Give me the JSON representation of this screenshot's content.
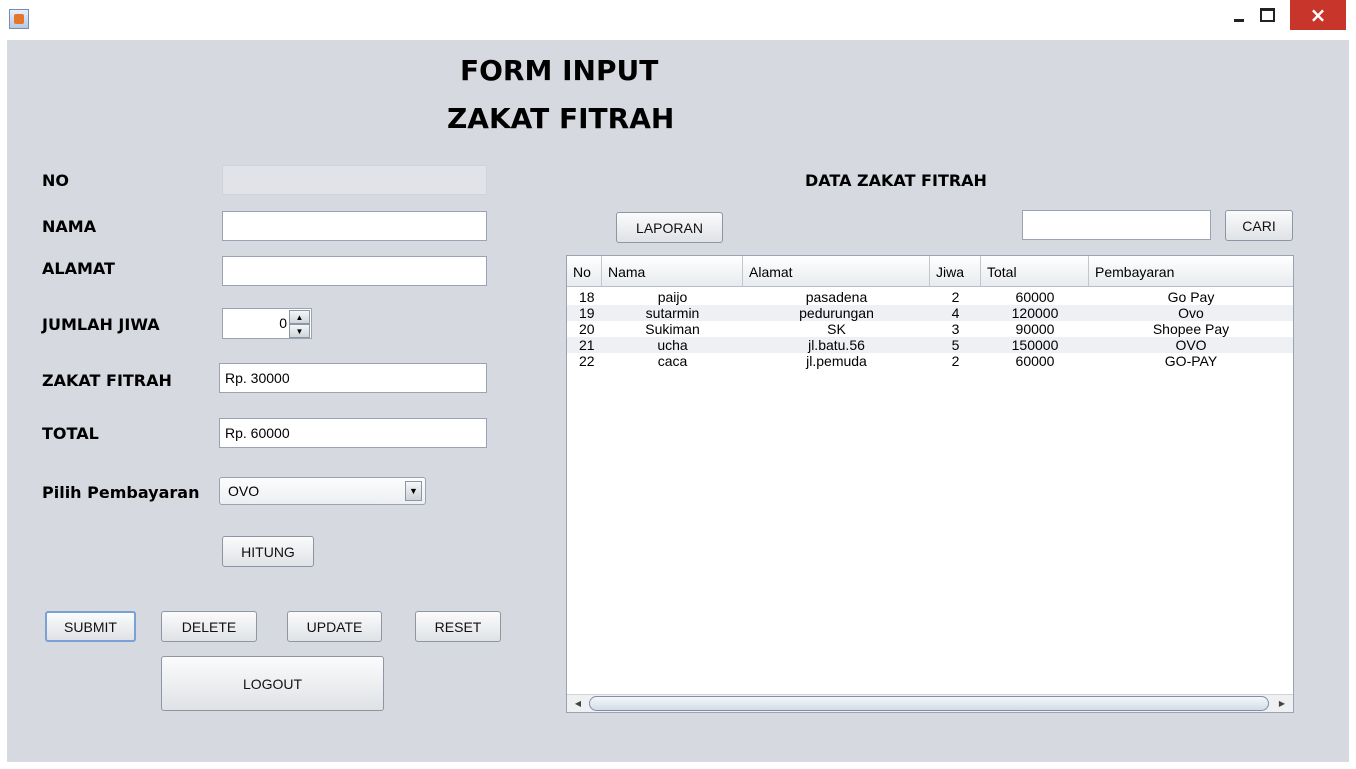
{
  "window": {
    "close_glyph": "×"
  },
  "title": {
    "line1": "FORM INPUT",
    "line2": "ZAKAT FITRAH"
  },
  "form": {
    "no_label": "NO",
    "no_value": "",
    "nama_label": "NAMA",
    "nama_value": "",
    "alamat_label": "ALAMAT",
    "alamat_value": "",
    "jumlah_jiwa_label": "JUMLAH JIWA",
    "jumlah_jiwa_value": "0",
    "zakat_fitrah_label": "ZAKAT FITRAH",
    "zakat_fitrah_value": "Rp. 30000",
    "total_label": "TOTAL",
    "total_value": "Rp. 60000",
    "pembayaran_label": "Pilih Pembayaran",
    "pembayaran_value": "OVO"
  },
  "buttons": {
    "hitung": "HITUNG",
    "submit": "SUBMIT",
    "delete": "DELETE",
    "update": "UPDATE",
    "reset": "RESET",
    "logout": "LOGOUT",
    "laporan": "LAPORAN",
    "cari": "CARI"
  },
  "search": {
    "value": ""
  },
  "data_panel": {
    "title": "DATA ZAKAT FITRAH",
    "columns": [
      "No",
      "Nama",
      "Alamat",
      "Jiwa",
      "Total",
      "Pembayaran"
    ],
    "rows": [
      [
        "18",
        "paijo",
        "pasadena",
        "2",
        "60000",
        "Go Pay"
      ],
      [
        "19",
        "sutarmin",
        "pedurungan",
        "4",
        "120000",
        "Ovo"
      ],
      [
        "20",
        "Sukiman",
        "SK",
        "3",
        "90000",
        "Shopee Pay"
      ],
      [
        "21",
        "ucha",
        "jl.batu.56",
        "5",
        "150000",
        "OVO"
      ],
      [
        "22",
        "caca",
        "jl.pemuda",
        "2",
        "60000",
        "GO-PAY"
      ]
    ]
  },
  "icons": {
    "app": "java-app-icon",
    "spinner_up": "▲",
    "spinner_down": "▼",
    "combo_arrow": "▼",
    "scroll_left": "◀",
    "scroll_right": "▶"
  }
}
